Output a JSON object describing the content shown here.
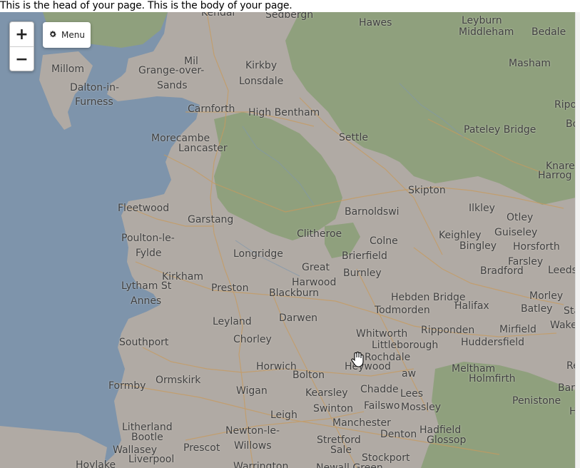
{
  "page": {
    "text": "This is the head of your page. This is the body of your page."
  },
  "controls": {
    "zoom_in": "+",
    "zoom_out": "−",
    "menu_label": "Menu",
    "menu_icon": "gear-icon"
  },
  "colors": {
    "sea": "#7e94ab",
    "land": "#b0aaa4",
    "national_park": "#8fa07d",
    "road": "#c79a5e"
  },
  "places": {
    "sedbergh": "Sedbergh",
    "kendal": "Kendal",
    "hawes": "Hawes",
    "leyburn": "Leyburn",
    "middleham": "Middleham",
    "bedale": "Bedale",
    "mill": "Mil",
    "millom": "Millom",
    "grange1": "Grange-over-",
    "grange2": "Sands",
    "kirkby1": "Kirkby",
    "kirkby2": "Lonsdale",
    "masham": "Masham",
    "dalton1": "Dalton-in-",
    "dalton2": "Furness",
    "carnforth": "Carnforth",
    "highbentham": "High Bentham",
    "ripon": "Ripo",
    "settle": "Settle",
    "pateley": "Pateley Bridge",
    "bo": "Bo",
    "morecambe": "Morecambe",
    "lancaster": "Lancaster",
    "knare": "Knare",
    "harrog": "Harrog",
    "skipton": "Skipton",
    "fleetwood": "Fleetwood",
    "barnoldswick": "Barnoldswi",
    "ilkley": "Ilkley",
    "garstang": "Garstang",
    "otley": "Otley",
    "clitheroe": "Clitheroe",
    "colne": "Colne",
    "keighley": "Keighley",
    "guiseley": "Guiseley",
    "poulton1": "Poulton-le-",
    "poulton2": "Fylde",
    "bingley": "Bingley",
    "horsforth": "Horsforth",
    "longridge": "Longridge",
    "brierfield": "Brierfield",
    "great": "Great",
    "harwood": "Harwood",
    "burnley": "Burnley",
    "farsley": "Farsley",
    "kirkham": "Kirkham",
    "bradford": "Bradford",
    "leeds": "Leeds",
    "lytham1": "Lytham St",
    "lytham2": "Annes",
    "preston": "Preston",
    "blackburn": "Blackburn",
    "hebden": "Hebden Bridge",
    "morley": "Morley",
    "halifax": "Halifax",
    "todmorden": "Todmorden",
    "batley": "Batley",
    "sta": "Sta",
    "leyland": "Leyland",
    "darwen": "Darwen",
    "wake": "Wake",
    "whitworth": "Whitworth",
    "ripponden": "Ripponden",
    "mirfield": "Mirfield",
    "chorley": "Chorley",
    "southport": "Southport",
    "littleborough": "Littleborough",
    "huddersfield": "Huddersfield",
    "rochdale": "Rochdale",
    "horwich": "Horwich",
    "heywood": "Heywood",
    "meltham": "Meltham",
    "re": "Re",
    "bolton": "Bolton",
    "aw": "aw",
    "ormskirk": "Ormskirk",
    "holmfirth": "Holmfirth",
    "formby": "Formby",
    "chadderton": "Chadde",
    "bar": "Bar",
    "wigan": "Wigan",
    "kearsley": "Kearsley",
    "lees": "Lees",
    "penistone": "Penistone",
    "failsworth": "Failswo",
    "mossley": "Mossley",
    "swinton": "Swinton",
    "h": "H",
    "leigh": "Leigh",
    "manchester": "Manchester",
    "litherland": "Litherland",
    "bootle": "Bootle",
    "newton1": "Newton-le-",
    "newton2": "Willows",
    "denton": "Denton",
    "hadfield": "Hadfield",
    "glossop": "Glossop",
    "stretford": "Stretford",
    "sale": "Sale",
    "prescot": "Prescot",
    "wallasey": "Wallasey",
    "liverpool": "Liverpool",
    "stockport": "Stockport",
    "hoylake": "Hoylake",
    "warrington": "Warrington",
    "newall": "Newall Green"
  }
}
